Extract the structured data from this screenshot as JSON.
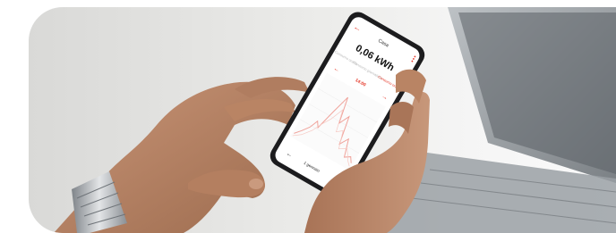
{
  "app": {
    "title": "Casa",
    "reading": "0,06 kWh",
    "tabs": [
      "Consumo orario",
      "Consumo giornaliero",
      "Consumo orario"
    ],
    "time_label": "14:00",
    "date_label": "1 gennaio"
  },
  "colors": {
    "accent": "#e53a2b",
    "chart_line": "#f0a39b",
    "phone_body": "#1c1c1e",
    "screen_bg": "#ffffff",
    "skin": "#b98666"
  },
  "icons": [
    "back-arrow-icon",
    "menu-dots-icon",
    "chevron-left-icon",
    "chevron-right-icon",
    "watch-icon"
  ]
}
